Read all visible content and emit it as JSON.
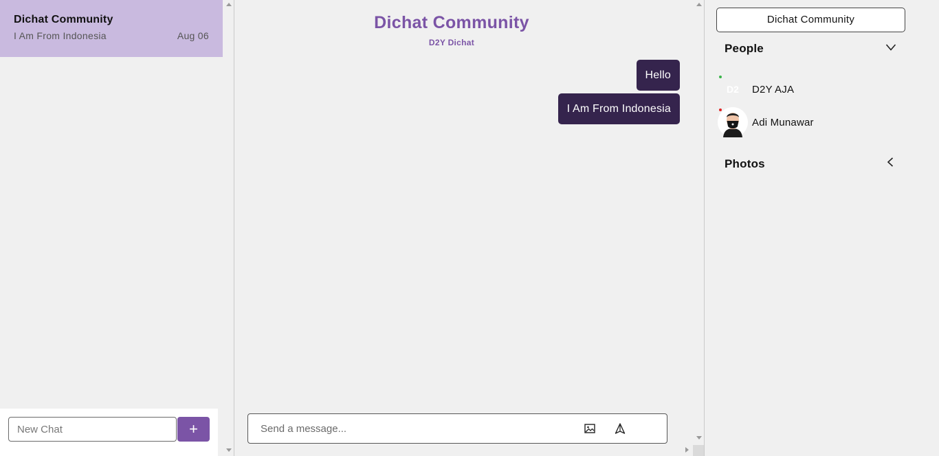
{
  "sidebar": {
    "chats": [
      {
        "title": "Dichat Community",
        "last_message": "I Am From Indonesia",
        "date": "Aug 06"
      }
    ],
    "new_chat": {
      "placeholder": "New Chat",
      "add_label": "+"
    }
  },
  "room": {
    "title": "Dichat Community",
    "subtitle": "D2Y Dichat",
    "messages": [
      {
        "text": "Hello"
      },
      {
        "text": "I Am From Indonesia"
      }
    ],
    "composer": {
      "placeholder": "Send a message..."
    }
  },
  "details": {
    "room_name": "Dichat Community",
    "people_label": "People",
    "people": [
      {
        "name": "D2Y AJA",
        "avatar_text": "D2",
        "status_color": "#3bb54a"
      },
      {
        "name": "Adi Munawar",
        "avatar_text": "",
        "status_color": "#e02424"
      }
    ],
    "photos_label": "Photos"
  },
  "colors": {
    "accent": "#7b54a6",
    "selected_chat": "#c9badf",
    "message_bubble": "#35244d"
  },
  "icons": [
    "image-icon",
    "send-icon",
    "chevron-down-icon",
    "chevron-left-icon",
    "plus-icon"
  ]
}
